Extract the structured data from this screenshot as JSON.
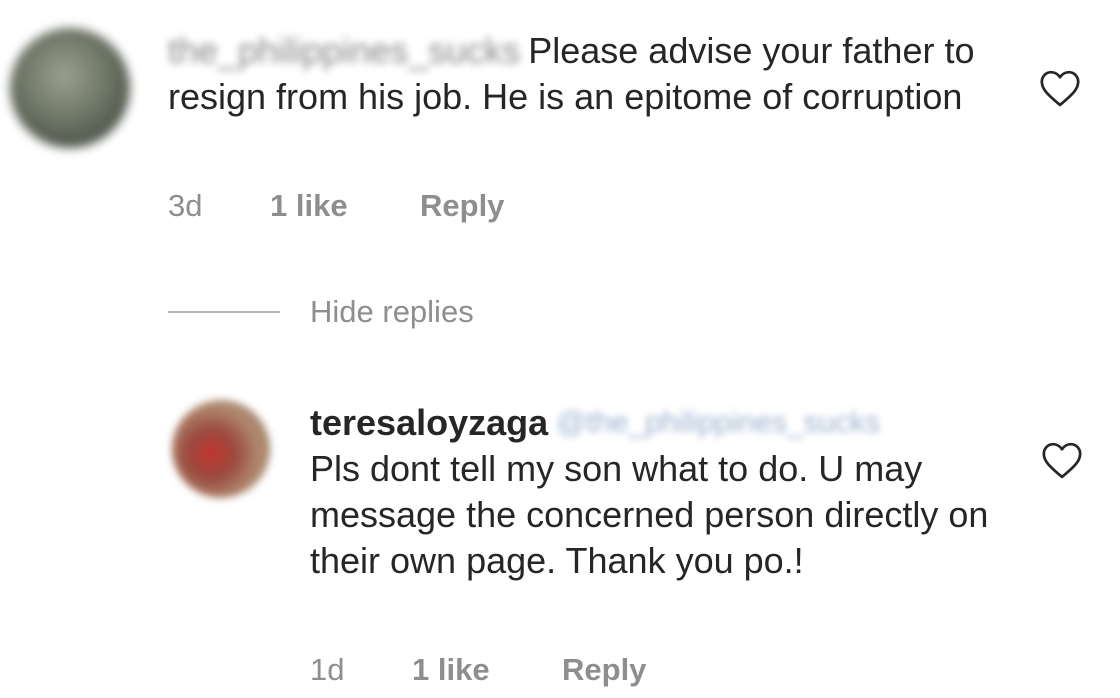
{
  "comments": [
    {
      "username": "the_philippines_sucks",
      "text": "Please advise your father to resign from his job. He is an epitome of corruption",
      "time": "3d",
      "likes": "1 like",
      "reply_label": "Reply"
    },
    {
      "username": "teresaloyzaga",
      "mention": "@the_philippines_sucks",
      "text": "Pls dont tell my son what to do. U may message the concerned person directly on their own page. Thank you po.!",
      "time": "1d",
      "likes": "1 like",
      "reply_label": "Reply"
    }
  ],
  "hide_replies_label": "Hide replies",
  "icons": {
    "like": "heart-outline-icon"
  },
  "colors": {
    "text": "#262626",
    "secondary": "#8e8e8e",
    "mention": "#4a73a8"
  }
}
